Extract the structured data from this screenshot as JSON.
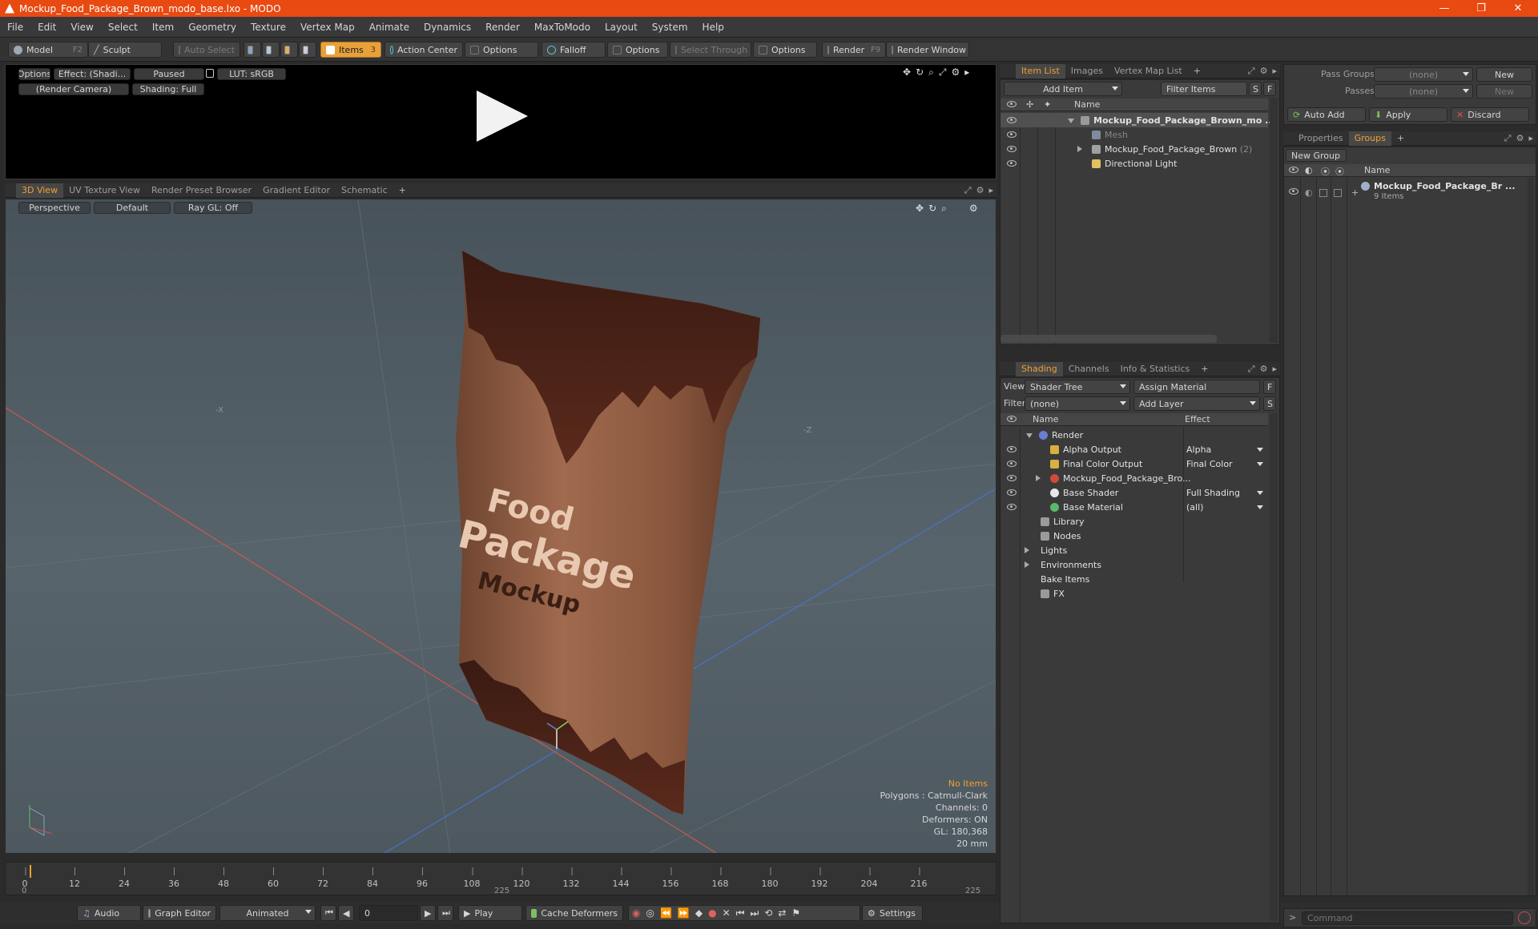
{
  "window": {
    "title": "Mockup_Food_Package_Brown_modo_base.lxo - MODO",
    "minimize": "—",
    "maximize": "❐",
    "close": "✕"
  },
  "menu": [
    "File",
    "Edit",
    "View",
    "Select",
    "Item",
    "Geometry",
    "Texture",
    "Vertex Map",
    "Animate",
    "Dynamics",
    "Render",
    "MaxToModo",
    "Layout",
    "System",
    "Help"
  ],
  "toolbar": {
    "model": "Model",
    "model_key": "F2",
    "sculpt": "Sculpt",
    "auto_select": "Auto Select",
    "items": "Items",
    "items_key": "3",
    "action_center": "Action Center",
    "options1": "Options",
    "falloff": "Falloff",
    "options2": "Options",
    "select_through": "Select Through",
    "options3": "Options",
    "render": "Render",
    "render_key": "F9",
    "render_window": "Render Window"
  },
  "preview": {
    "options": "Options",
    "effect": "Effect: (Shadi...",
    "paused": "Paused",
    "lut": "LUT: sRGB",
    "camera": "(Render Camera)",
    "shading": "Shading: Full"
  },
  "viewport_tabs": [
    "3D View",
    "UV Texture View",
    "Render Preset Browser",
    "Gradient Editor",
    "Schematic",
    "+"
  ],
  "viewport": {
    "perspective": "Perspective",
    "default": "Default",
    "raygl": "Ray GL: Off",
    "package_line1": "Food",
    "package_line2": "Package",
    "package_line3": "Mockup",
    "axis_labels": [
      "-X",
      "-Z"
    ],
    "info": {
      "no_items": "No Items",
      "polygons": "Polygons : Catmull-Clark",
      "channels": "Channels: 0",
      "deformers": "Deformers: ON",
      "gl": "GL: 180,368",
      "mm": "20 mm"
    }
  },
  "timeline": {
    "ticks": [
      "0",
      "12",
      "24",
      "36",
      "48",
      "60",
      "72",
      "84",
      "96",
      "108",
      "120",
      "132",
      "144",
      "156",
      "168",
      "180",
      "192",
      "204",
      "216"
    ],
    "start": "0",
    "mid": "225",
    "end": "225"
  },
  "bottom": {
    "audio": "Audio",
    "graph_editor": "Graph Editor",
    "animated": "Animated",
    "frame": "0",
    "play": "Play",
    "cache": "Cache Deformers",
    "settings": "Settings"
  },
  "itemlist": {
    "tabs": [
      "Item List",
      "Images",
      "Vertex Map List",
      "+"
    ],
    "add_item": "Add Item",
    "filter": "Filter Items",
    "s": "S",
    "f": "F",
    "col_name": "Name",
    "rows": [
      {
        "label": "Mockup_Food_Package_Brown_mo ...",
        "count": ""
      },
      {
        "label": "Mesh",
        "count": ""
      },
      {
        "label": "Mockup_Food_Package_Brown",
        "count": "(2)"
      },
      {
        "label": "Directional Light",
        "count": ""
      }
    ]
  },
  "shading": {
    "tabs": [
      "Shading",
      "Channels",
      "Info & Statistics",
      "+"
    ],
    "view_label": "View",
    "view_value": "Shader Tree",
    "assign": "Assign Material",
    "f": "F",
    "filter_label": "Filter",
    "filter_value": "(none)",
    "add_layer": "Add Layer",
    "s": "S",
    "col_name": "Name",
    "col_effect": "Effect",
    "rows": [
      {
        "name": "Render",
        "effect": ""
      },
      {
        "name": "Alpha Output",
        "effect": "Alpha"
      },
      {
        "name": "Final Color Output",
        "effect": "Final Color"
      },
      {
        "name": "Mockup_Food_Package_Bro...",
        "effect": ""
      },
      {
        "name": "Base Shader",
        "effect": "Full Shading"
      },
      {
        "name": "Base Material",
        "effect": "(all)"
      },
      {
        "name": "Library",
        "effect": ""
      },
      {
        "name": "Nodes",
        "effect": ""
      },
      {
        "name": "Lights",
        "effect": ""
      },
      {
        "name": "Environments",
        "effect": ""
      },
      {
        "name": "Bake Items",
        "effect": ""
      },
      {
        "name": "FX",
        "effect": ""
      }
    ]
  },
  "passes": {
    "pass_groups_label": "Pass Groups",
    "pass_groups_value": "(none)",
    "new1": "New",
    "passes_label": "Passes",
    "passes_value": "(none)",
    "new2": "New",
    "auto_add": "Auto Add",
    "apply": "Apply",
    "discard": "Discard"
  },
  "groups": {
    "tabs": [
      "Properties",
      "Groups",
      "+"
    ],
    "new_group": "New Group",
    "col_name": "Name",
    "item": "Mockup_Food_Package_Br ...",
    "sub": "9 Items"
  },
  "command": {
    "placeholder": "Command"
  }
}
